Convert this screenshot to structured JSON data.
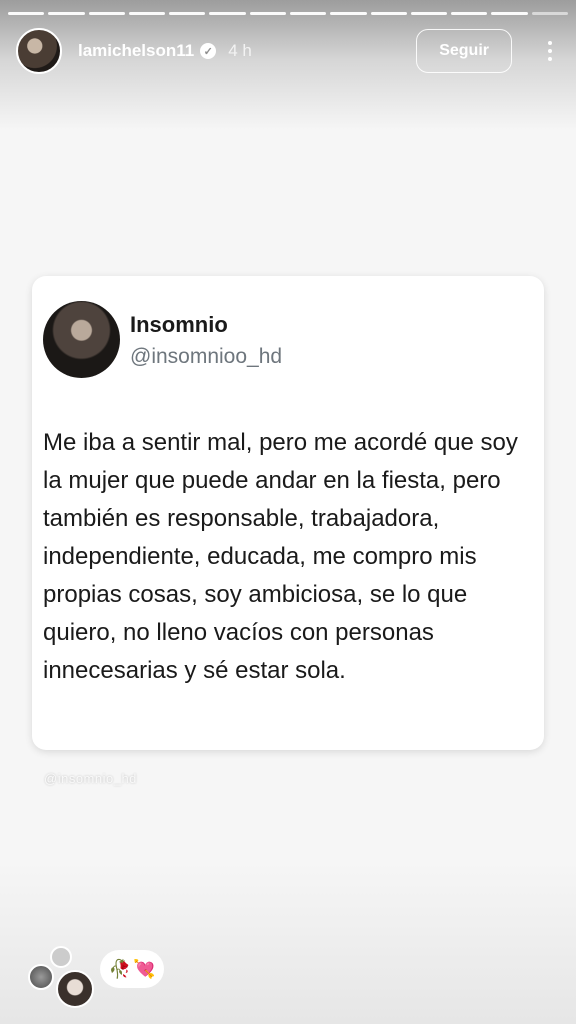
{
  "story": {
    "username": "lamichelson11",
    "time": "4 h",
    "follow_label": "Seguir",
    "progress_segments": 14,
    "seen_segments": 13
  },
  "tweet": {
    "name": "Insomnio",
    "handle": "@insomnioo_hd",
    "text": "Me iba a sentir mal, pero me acordé que soy la mujer que puede andar en la fiesta, pero también es responsable, trabajadora, independiente, educada, me compro mis propias cosas, soy ambiciosa, se lo que quiero, no lleno vacíos con personas innecesarias y sé estar sola."
  },
  "watermark": "@insomnio_hd",
  "reactions": {
    "icons": [
      "rose-icon",
      "heart-icon"
    ],
    "rose_glyph": "🥀",
    "heart_glyph": "💘"
  },
  "colors": {
    "handle": "#6e767d",
    "heart": "#e8368f"
  }
}
